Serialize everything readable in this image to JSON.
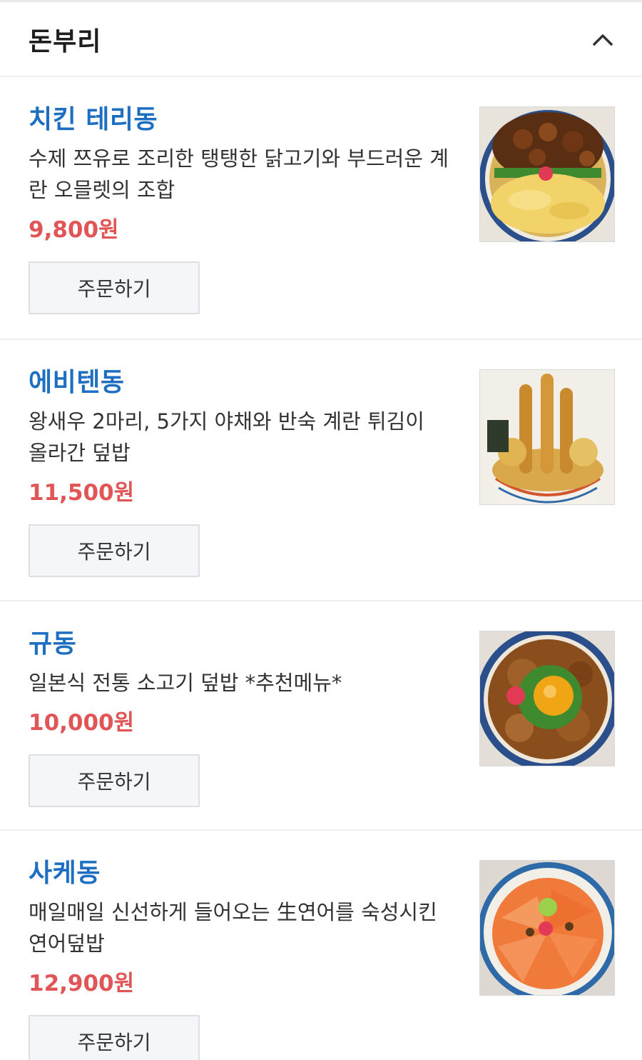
{
  "section": {
    "title": "돈부리"
  },
  "menu": [
    {
      "name": "치킨 테리동",
      "description": "수제 쯔유로 조리한 탱탱한 닭고기와 부드러운 계란 오믈렛의 조합",
      "price": "9,800원",
      "order_label": "주문하기"
    },
    {
      "name": "에비텐동",
      "description": "왕새우 2마리, 5가지 야채와 반숙 계란 튀김이 올라간 덮밥",
      "price": "11,500원",
      "order_label": "주문하기"
    },
    {
      "name": "규동",
      "description": "일본식 전통 소고기 덮밥 *추천메뉴*",
      "price": "10,000원",
      "order_label": "주문하기"
    },
    {
      "name": "사케동",
      "description": "매일매일 신선하게 들어오는 生연어를 숙성시킨 연어덮밥",
      "price": "12,900원",
      "order_label": "주문하기"
    }
  ],
  "colors": {
    "name": "#1e6fc2",
    "price": "#e05555",
    "title": "#1e1e1e"
  },
  "icons": {
    "collapse": "chevron-up-icon"
  }
}
